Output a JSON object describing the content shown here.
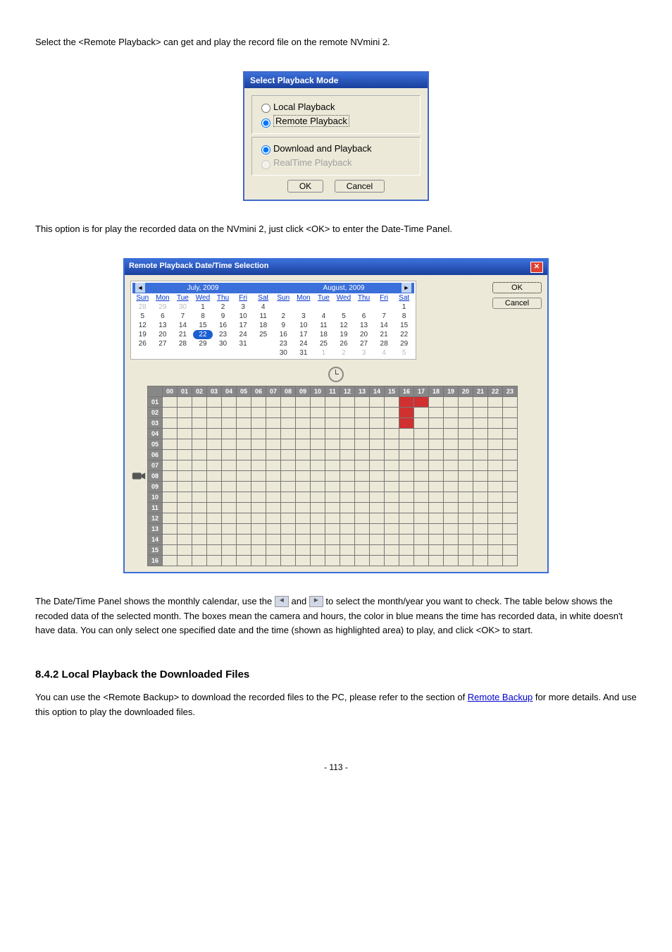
{
  "intro_paragraph": "Select the <Remote Playback> can get and play the record file on the remote NVmini 2.",
  "dialog1": {
    "title": "Select Playback Mode",
    "opt_local": "Local Playback",
    "opt_remote": "Remote Playback",
    "opt_download": "Download and Playback",
    "opt_realtime": "RealTime Playback",
    "ok": "OK",
    "cancel": "Cancel"
  },
  "after_dialog1": "This option is for play the recorded data on the NVmini 2, just click <OK> to enter the Date-Time Panel.",
  "dialog2": {
    "title": "Remote Playback Date/Time Selection",
    "ok": "OK",
    "cancel": "Cancel",
    "month1": "July, 2009",
    "month2": "August, 2009",
    "dow": [
      "Sun",
      "Mon",
      "Tue",
      "Wed",
      "Thu",
      "Fri",
      "Sat"
    ],
    "cal1_rows": [
      [
        "28",
        "29",
        "30",
        "1",
        "2",
        "3",
        "4"
      ],
      [
        "5",
        "6",
        "7",
        "8",
        "9",
        "10",
        "11"
      ],
      [
        "12",
        "13",
        "14",
        "15",
        "16",
        "17",
        "18"
      ],
      [
        "19",
        "20",
        "21",
        "22",
        "23",
        "24",
        "25"
      ],
      [
        "26",
        "27",
        "28",
        "29",
        "30",
        "31",
        ""
      ]
    ],
    "cal1_dim_first_row_count": 3,
    "cal1_selected": "22",
    "cal2_rows": [
      [
        "",
        "",
        "",
        "",
        "",
        "",
        "1"
      ],
      [
        "2",
        "3",
        "4",
        "5",
        "6",
        "7",
        "8"
      ],
      [
        "9",
        "10",
        "11",
        "12",
        "13",
        "14",
        "15"
      ],
      [
        "16",
        "17",
        "18",
        "19",
        "20",
        "21",
        "22"
      ],
      [
        "23",
        "24",
        "25",
        "26",
        "27",
        "28",
        "29"
      ],
      [
        "30",
        "31",
        "1",
        "2",
        "3",
        "4",
        "5"
      ]
    ],
    "cal2_dim_last_row_from": 2,
    "hours": [
      "00",
      "01",
      "02",
      "03",
      "04",
      "05",
      "06",
      "07",
      "08",
      "09",
      "10",
      "11",
      "12",
      "13",
      "14",
      "15",
      "16",
      "17",
      "18",
      "19",
      "20",
      "21",
      "22",
      "23"
    ],
    "rows": [
      "01",
      "02",
      "03",
      "04",
      "05",
      "06",
      "07",
      "08",
      "09",
      "10",
      "11",
      "12",
      "13",
      "14",
      "15",
      "16"
    ],
    "data_cells": {
      "01": [
        16,
        17
      ],
      "02": [
        16
      ],
      "03": [
        16
      ]
    }
  },
  "para2_prefix": "The Date/Time Panel shows the monthly calendar, use the ",
  "para2_mid": " and ",
  "para2_suffix": " to select the month/year you want to check. The table below shows the recoded data of the selected month. The boxes mean the camera and hours, the color in blue means the time has recorded data, ",
  "para2_white": "in white doesn't have data. You can only ",
  "para2_end": "select one specified date and the time (shown as highlighted area) to play, and click <OK> to start.",
  "section_title": "8.4.2 Local Playback the Downloaded Files",
  "para3_a": "You can use the <Remote Backup> to download the recorded files to the PC, please refer to the section of ",
  "para3_link": "Remote Backup",
  "para3_b": " for more details. And use this option to play the downloaded files.",
  "page_number": "- 113 -"
}
